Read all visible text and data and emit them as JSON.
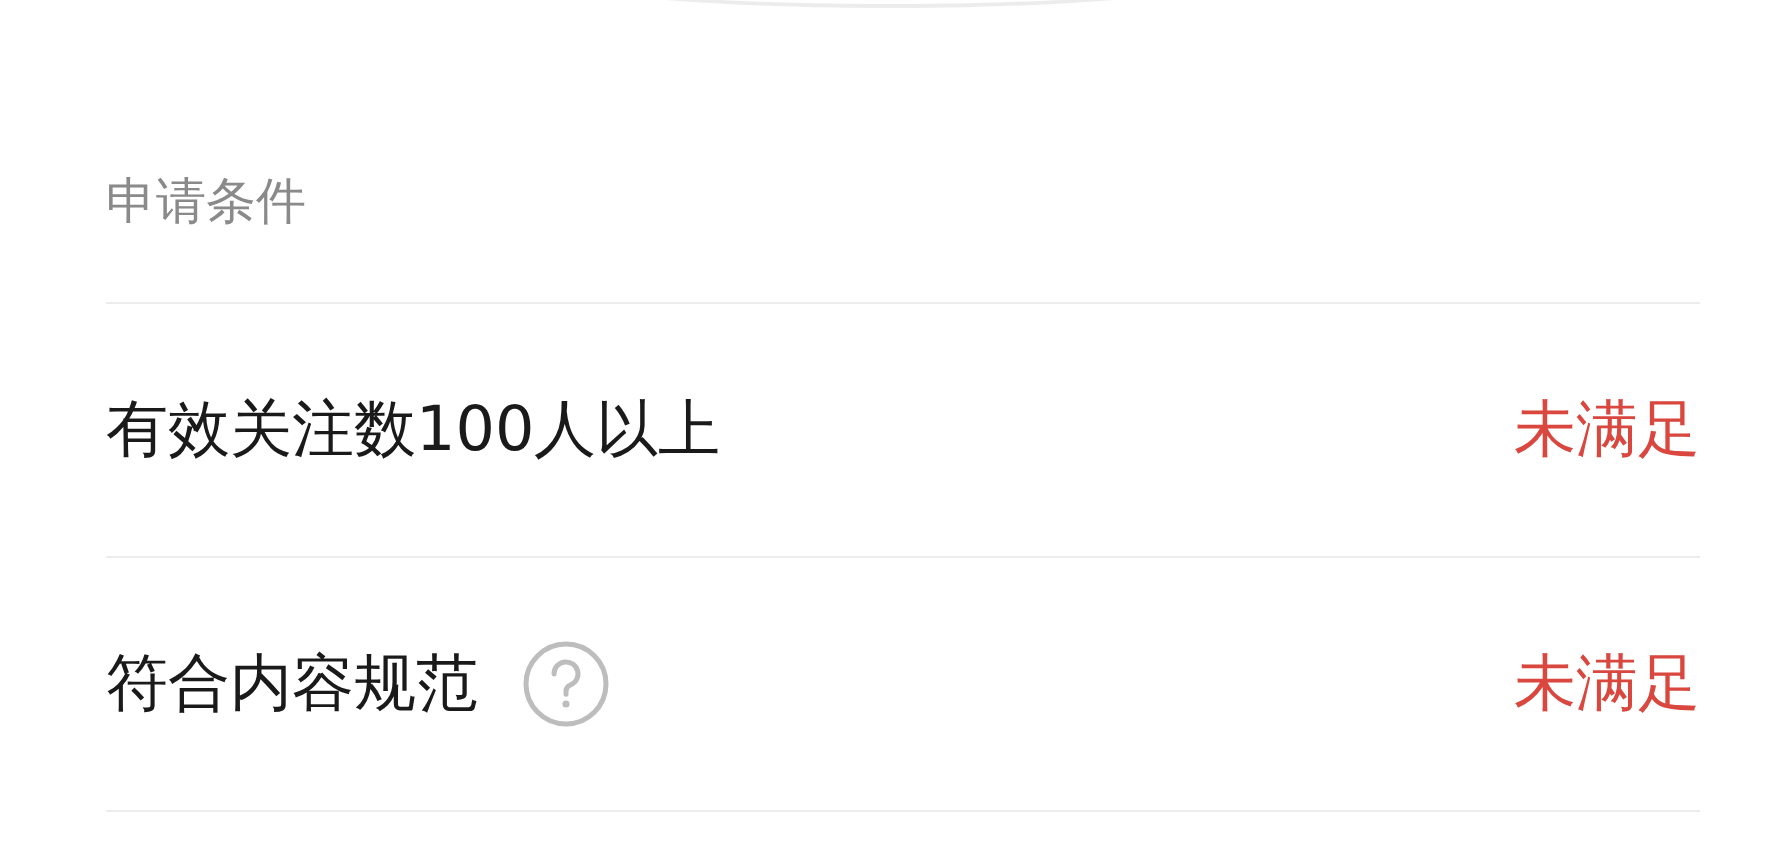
{
  "section_title": "申请条件",
  "conditions": [
    {
      "label": "有效关注数100人以上",
      "status": "未满足",
      "met": false,
      "help": false
    },
    {
      "label": "符合内容规范",
      "status": "未满足",
      "met": false,
      "help": true
    }
  ]
}
